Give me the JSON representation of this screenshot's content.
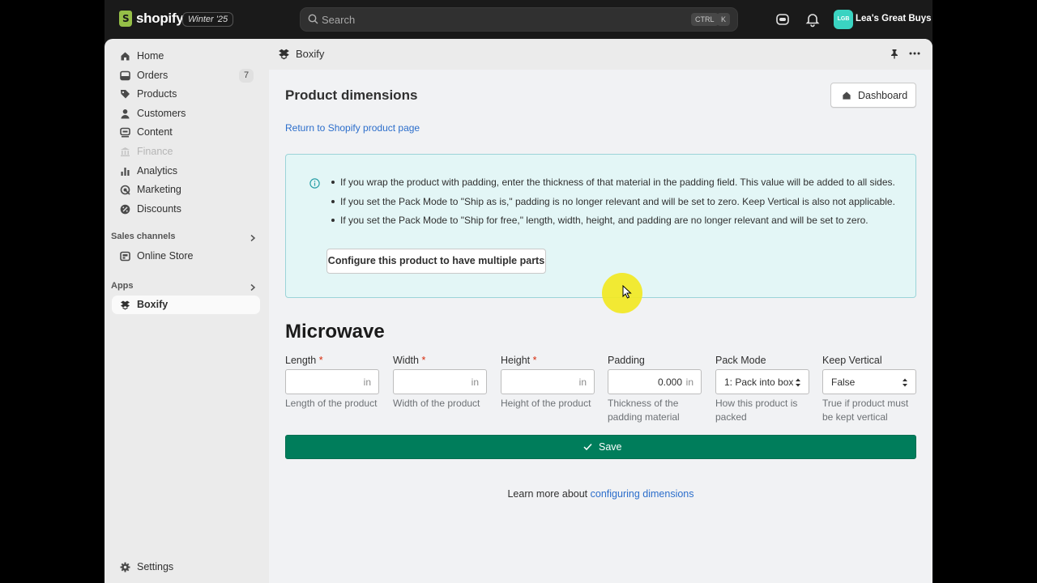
{
  "topbar": {
    "brand": "shopify",
    "edition_badge": "Winter '25",
    "search_placeholder": "Search",
    "shortcut_keys": [
      "CTRL",
      "K"
    ],
    "avatar_initials": "LGB",
    "store_name": "Lea's Great Buys",
    "colors": {
      "background": "#1a1a1a",
      "avatar": "#3ad3c1",
      "brand_green": "#95bf47"
    }
  },
  "sidebar": {
    "items": [
      {
        "label": "Home",
        "icon": "home-icon"
      },
      {
        "label": "Orders",
        "icon": "orders-icon",
        "count": "7"
      },
      {
        "label": "Products",
        "icon": "tag-icon"
      },
      {
        "label": "Customers",
        "icon": "person-icon"
      },
      {
        "label": "Content",
        "icon": "content-icon"
      },
      {
        "label": "Finance",
        "icon": "bank-icon",
        "disabled": true
      },
      {
        "label": "Analytics",
        "icon": "bar-chart-icon"
      },
      {
        "label": "Marketing",
        "icon": "target-icon"
      },
      {
        "label": "Discounts",
        "icon": "discount-icon"
      }
    ],
    "sales_channels_title": "Sales channels",
    "sales_channels": [
      {
        "label": "Online Store",
        "icon": "store-icon"
      }
    ],
    "apps_title": "Apps",
    "apps": [
      {
        "label": "Boxify",
        "icon": "boxify-icon",
        "active": true
      }
    ],
    "settings_label": "Settings"
  },
  "app": {
    "name": "Boxify",
    "page_title": "Product dimensions",
    "dashboard_button": "Dashboard",
    "return_link": "Return to Shopify product page",
    "banner": {
      "bullets": [
        "If you wrap the product with padding, enter the thickness of that material in the padding field. This value will be added to all sides.",
        "If you set the Pack Mode to \"Ship as is,\" padding is no longer relevant and will be set to zero. Keep Vertical is also not applicable.",
        "If you set the Pack Mode to \"Ship for free,\" length, width, height, and padding are no longer relevant and will be set to zero."
      ],
      "configure_button": "Configure this product to have multiple parts",
      "colors": {
        "background": "#e3f6f6",
        "border": "#9cd4d8"
      }
    },
    "product_name": "Microwave",
    "fields": [
      {
        "label": "Length",
        "required": "*",
        "value": "",
        "unit": "in",
        "help": "Length of the product"
      },
      {
        "label": "Width",
        "required": "*",
        "value": "",
        "unit": "in",
        "help": "Width of the product"
      },
      {
        "label": "Height",
        "required": "*",
        "value": "",
        "unit": "in",
        "help": "Height of the product"
      },
      {
        "label": "Padding",
        "value": "0.000",
        "unit": "in",
        "help_line1": "Thickness of the",
        "help_line2": "padding material"
      },
      {
        "label": "Pack Mode",
        "value": "1: Pack into box",
        "help_line1": "How this product is",
        "help_line2": "packed"
      },
      {
        "label": "Keep Vertical",
        "value": "False",
        "help_line1": "True if product must",
        "help_line2": "be kept vertical"
      }
    ],
    "save_button": "Save",
    "save_color": "#007d5b",
    "learn_more_prefix": "Learn more about",
    "learn_more_link": "configuring dimensions"
  }
}
